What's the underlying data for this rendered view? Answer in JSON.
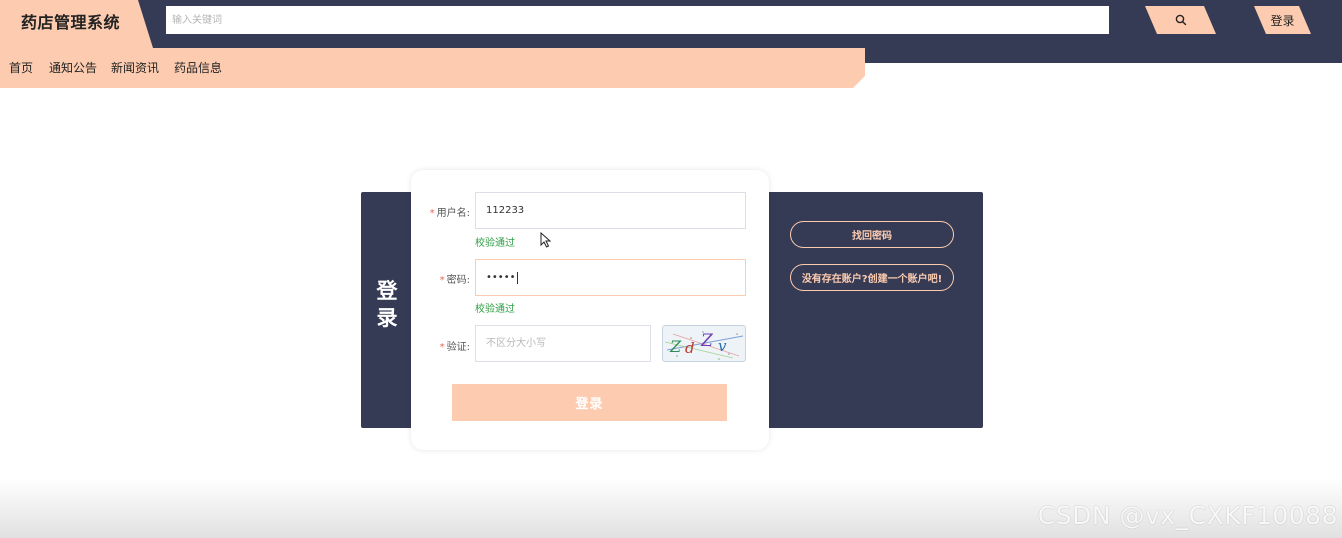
{
  "header": {
    "app_title": "药店管理系统",
    "search_placeholder": "输入关键词",
    "search_icon": "search-icon",
    "login_label": "登录"
  },
  "nav": {
    "items": [
      {
        "label": "首页"
      },
      {
        "label": "通知公告"
      },
      {
        "label": "新闻资讯"
      },
      {
        "label": "药品信息"
      }
    ]
  },
  "login": {
    "title": "登录",
    "username": {
      "label": "用户名:",
      "value": "112233",
      "validation": "校验通过"
    },
    "password": {
      "label": "密码:",
      "value": "•••••",
      "validation": "校验通过"
    },
    "captcha": {
      "label": "验证:",
      "placeholder": "不区分大小写",
      "image_text": "ZdZv"
    },
    "submit_label": "登录",
    "required_mark": "*"
  },
  "side_actions": {
    "forgot_password": "找回密码",
    "register": "没有存在账户?创建一个账户吧!"
  },
  "colors": {
    "accent": "#fdccb0",
    "dark": "#363b55",
    "valid": "#2f9e44",
    "required": "#e8655b"
  },
  "watermark": "CSDN @vx_CXKF10088"
}
